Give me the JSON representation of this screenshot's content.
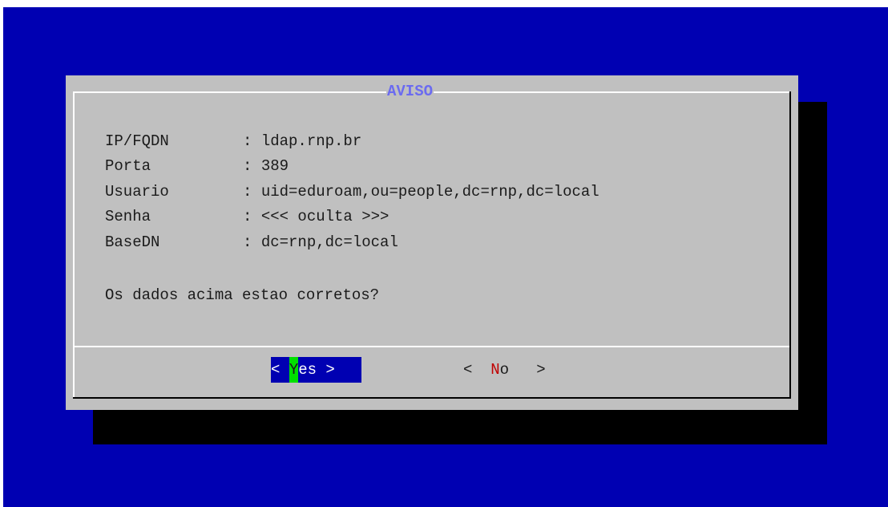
{
  "dialog": {
    "title": "AVISO",
    "fields": [
      {
        "label": "IP/FQDN",
        "sep": ": ",
        "value": "ldap.rnp.br"
      },
      {
        "label": "Porta",
        "sep": ": ",
        "value": "389"
      },
      {
        "label": "Usuario",
        "sep": ": ",
        "value": "uid=eduroam,ou=people,dc=rnp,dc=local"
      },
      {
        "label": "Senha",
        "sep": ": ",
        "value": "<<< oculta >>>"
      },
      {
        "label": "BaseDN",
        "sep": ": ",
        "value": "dc=rnp,dc=local"
      }
    ],
    "question": "Os dados acima estao corretos?"
  },
  "buttons": {
    "yes": {
      "open": "< ",
      "hotkey": "Y",
      "rest": "es",
      "close": " >"
    },
    "no": {
      "open": "<  ",
      "hotkey": "N",
      "rest": "o",
      "close": "   >"
    }
  },
  "colors": {
    "background": "#0000b2",
    "dialog": "#c0c0c0",
    "title": "#6b6bf0",
    "selected_button": "#0000b2",
    "hotkey_highlight": "#00e000",
    "hotkey_text": "#c00000"
  }
}
